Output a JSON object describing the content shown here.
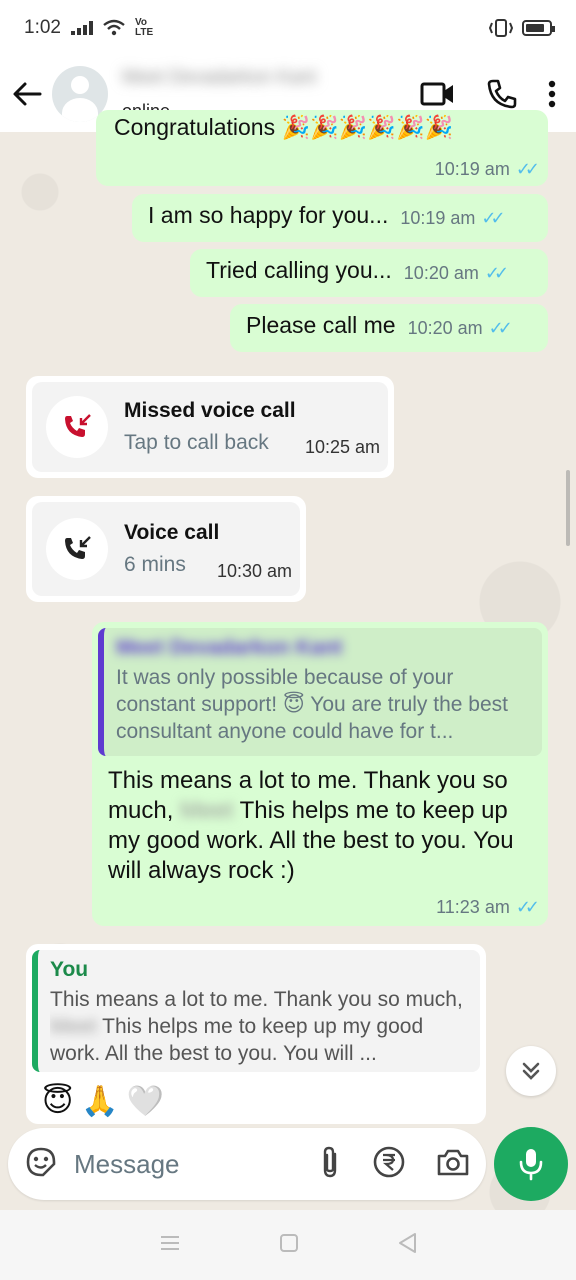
{
  "status_bar": {
    "time": "1:02",
    "volte": "Vo LTE"
  },
  "header": {
    "contact_name": "Meet Devadarkon Kant",
    "status": "online"
  },
  "messages": {
    "m1": {
      "text": "Congratulations 🎉🎉🎉🎉🎉🎉",
      "time": "10:19 am"
    },
    "m2": {
      "text": "I am so happy for you...",
      "time": "10:19 am"
    },
    "m3": {
      "text": "Tried calling you...",
      "time": "10:20 am"
    },
    "m4": {
      "text": "Please call me",
      "time": "10:20 am"
    },
    "call1": {
      "title": "Missed voice call",
      "subtitle": "Tap to call back",
      "time": "10:25 am"
    },
    "call2": {
      "title": "Voice call",
      "subtitle": "6 mins",
      "time": "10:30 am"
    },
    "m5": {
      "quote_author": "Meet Devadarkon Kant",
      "quote_text": "It was only possible because of your constant support! 😇 You are truly the best consultant anyone could have for t...",
      "text_part1": "This means a lot to me. Thank you so much,",
      "name_blur": "Meet",
      "text_part2": " This helps me to keep up my good work.  All the best to you. You will always rock :)",
      "time": "11:23 am"
    },
    "m6": {
      "quote_author": "You",
      "quote_text_part1": "This means a lot to me. Thank you so much,",
      "name_blur": "Meet",
      "quote_text_part2": " This helps me to keep up my good work.  All the best to you. You will ...",
      "emojis": "😇🙏🤍"
    }
  },
  "composer": {
    "placeholder": "Message"
  },
  "colors": {
    "outgoing_bubble": "#d9fdd3",
    "incoming_bubble": "#ffffff",
    "accent_green": "#1daa61",
    "tick_blue": "#53bdeb",
    "missed_call_red": "#c8102e",
    "quote_bar_purple": "#5e3bd0",
    "quote_bar_green": "#1daa61"
  },
  "icons": {
    "back": "arrow-left-icon",
    "video": "video-call-icon",
    "phone": "voice-call-icon",
    "menu": "more-vert-icon",
    "sticker": "sticker-icon",
    "attach": "paperclip-icon",
    "payment": "rupee-icon",
    "camera": "camera-icon",
    "mic": "mic-icon",
    "scroll": "double-chevron-down-icon"
  }
}
